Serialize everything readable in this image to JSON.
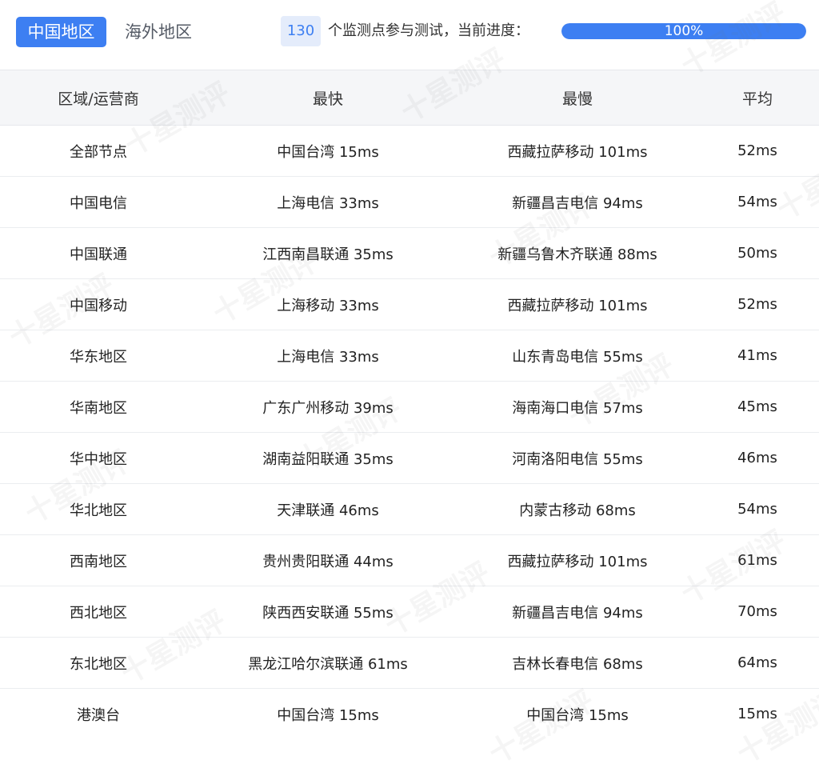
{
  "tabs": {
    "active_label": "中国地区",
    "inactive_label": "海外地区"
  },
  "progress": {
    "count": "130",
    "label": "个监测点参与测试，当前进度：",
    "percent_text": "100%",
    "fraction": 1.0
  },
  "table": {
    "headers": [
      "区域/运营商",
      "最快",
      "最慢",
      "平均"
    ],
    "rows": [
      [
        "全部节点",
        "中国台湾 15ms",
        "西藏拉萨移动 101ms",
        "52ms"
      ],
      [
        "中国电信",
        "上海电信 33ms",
        "新疆昌吉电信 94ms",
        "54ms"
      ],
      [
        "中国联通",
        "江西南昌联通 35ms",
        "新疆乌鲁木齐联通 88ms",
        "50ms"
      ],
      [
        "中国移动",
        "上海移动 33ms",
        "西藏拉萨移动 101ms",
        "52ms"
      ],
      [
        "华东地区",
        "上海电信 33ms",
        "山东青岛电信 55ms",
        "41ms"
      ],
      [
        "华南地区",
        "广东广州移动 39ms",
        "海南海口电信 57ms",
        "45ms"
      ],
      [
        "华中地区",
        "湖南益阳联通 35ms",
        "河南洛阳电信 55ms",
        "46ms"
      ],
      [
        "华北地区",
        "天津联通 46ms",
        "内蒙古移动 68ms",
        "54ms"
      ],
      [
        "西南地区",
        "贵州贵阳联通 44ms",
        "西藏拉萨移动 101ms",
        "61ms"
      ],
      [
        "西北地区",
        "陕西西安联通 55ms",
        "新疆昌吉电信 94ms",
        "70ms"
      ],
      [
        "东北地区",
        "黑龙江哈尔滨联通 61ms",
        "吉林长春电信 68ms",
        "64ms"
      ],
      [
        "港澳台",
        "中国台湾 15ms",
        "中国台湾 15ms",
        "15ms"
      ]
    ]
  },
  "watermark_text": "十星测评",
  "colors": {
    "accent": "#3d7ff2",
    "badge_bg": "#e4ecfb",
    "header_bg": "#f5f6f8"
  }
}
